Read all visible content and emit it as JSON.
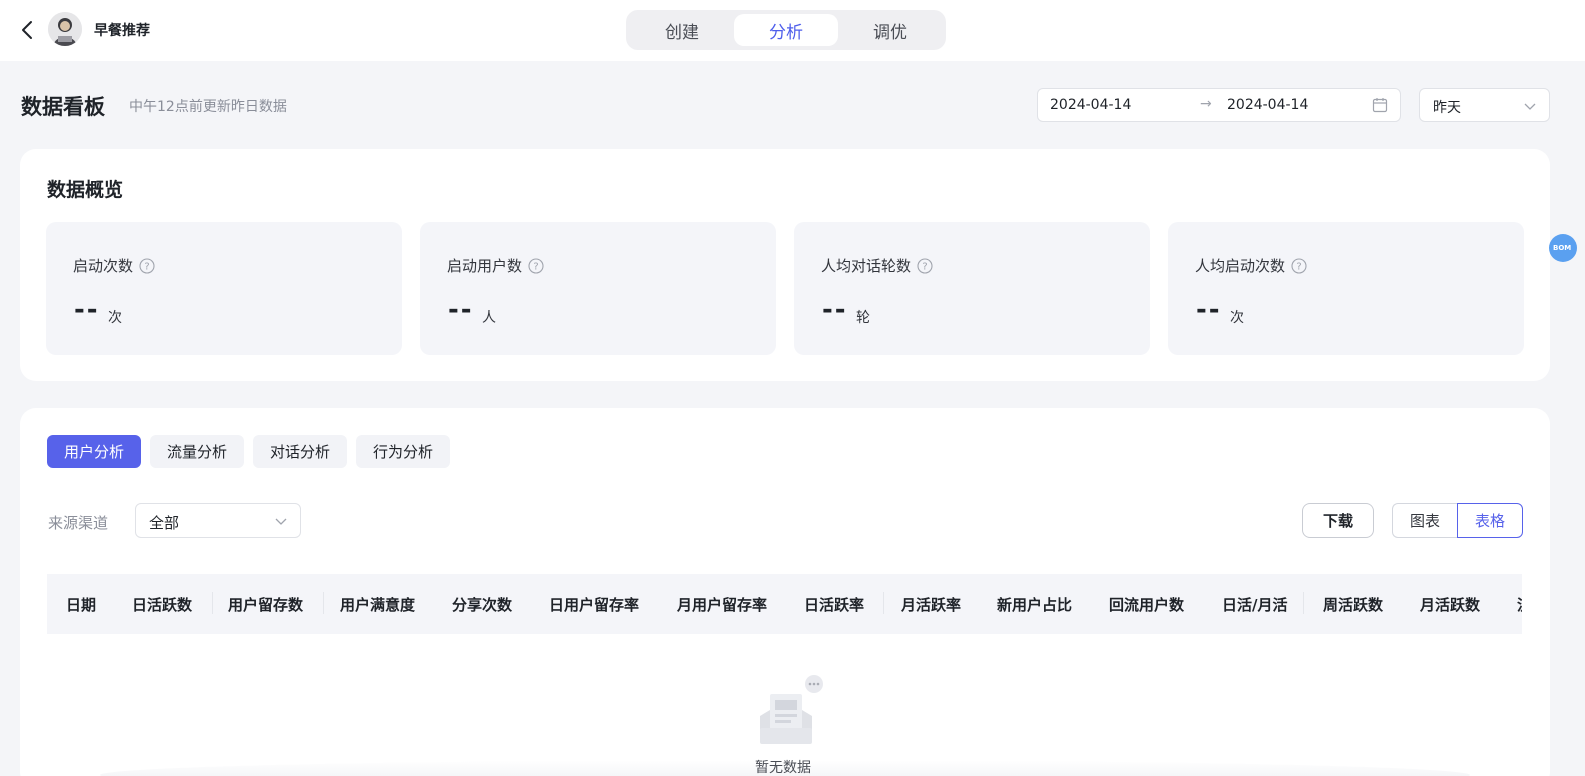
{
  "header": {
    "app_title": "早餐推荐",
    "tabs": [
      {
        "label": "创建",
        "active": false
      },
      {
        "label": "分析",
        "active": true
      },
      {
        "label": "调优",
        "active": false
      }
    ]
  },
  "dashboard": {
    "title": "数据看板",
    "subtitle": "中午12点前更新昨日数据",
    "date_start": "2024-04-14",
    "date_arrow": "→",
    "date_end": "2024-04-14",
    "period": "昨天"
  },
  "overview": {
    "title": "数据概览",
    "metrics": [
      {
        "label": "启动次数",
        "value": "--",
        "unit": "次"
      },
      {
        "label": "启动用户数",
        "value": "--",
        "unit": "人"
      },
      {
        "label": "人均对话轮数",
        "value": "--",
        "unit": "轮"
      },
      {
        "label": "人均启动次数",
        "value": "--",
        "unit": "次"
      }
    ]
  },
  "side_bubble": "BOM",
  "analysis": {
    "tabs": [
      {
        "label": "用户分析",
        "active": true
      },
      {
        "label": "流量分析",
        "active": false
      },
      {
        "label": "对话分析",
        "active": false
      },
      {
        "label": "行为分析",
        "active": false
      }
    ],
    "source_label": "来源渠道",
    "source_value": "全部",
    "download_label": "下载",
    "view_chart_label": "图表",
    "view_table_label": "表格",
    "columns": [
      "日期",
      "日活跃数",
      "用户留存数",
      "用户满意度",
      "分享次数",
      "日用户留存率",
      "月用户留存率",
      "日活跃率",
      "月活跃率",
      "新用户占比",
      "回流用户数",
      "日活/月活",
      "周活跃数",
      "月活跃数",
      "流"
    ],
    "empty_text": "暂无数据"
  },
  "colors": {
    "accent": "#5762ea",
    "page_bg": "#f4f5f8"
  }
}
